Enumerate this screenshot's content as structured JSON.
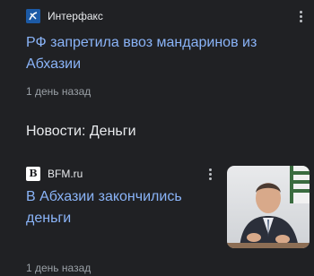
{
  "feed": {
    "story1": {
      "source_name": "Интерфакс",
      "source_logo_icon": "interfax-logo-icon",
      "headline": "РФ запретила ввоз мандаринов из Абхазии",
      "time": "1 день назад"
    },
    "section": {
      "title": "Новости: Деньги"
    },
    "story2": {
      "source_name": "BFM.ru",
      "source_logo_icon": "bfm-logo-icon",
      "source_logo_text": "B",
      "headline": "В Абхазии закончились деньги",
      "time": "1 день назад",
      "thumbnail_icon": "news-photo-thumbnail"
    },
    "more_icon": "more-vert-icon"
  },
  "colors": {
    "background": "#202124",
    "headline_link": "#8ab4f8",
    "primary_text": "#e8eaed",
    "secondary_text": "#9aa0a6",
    "interfax_logo_bg": "#1c5aa6"
  }
}
